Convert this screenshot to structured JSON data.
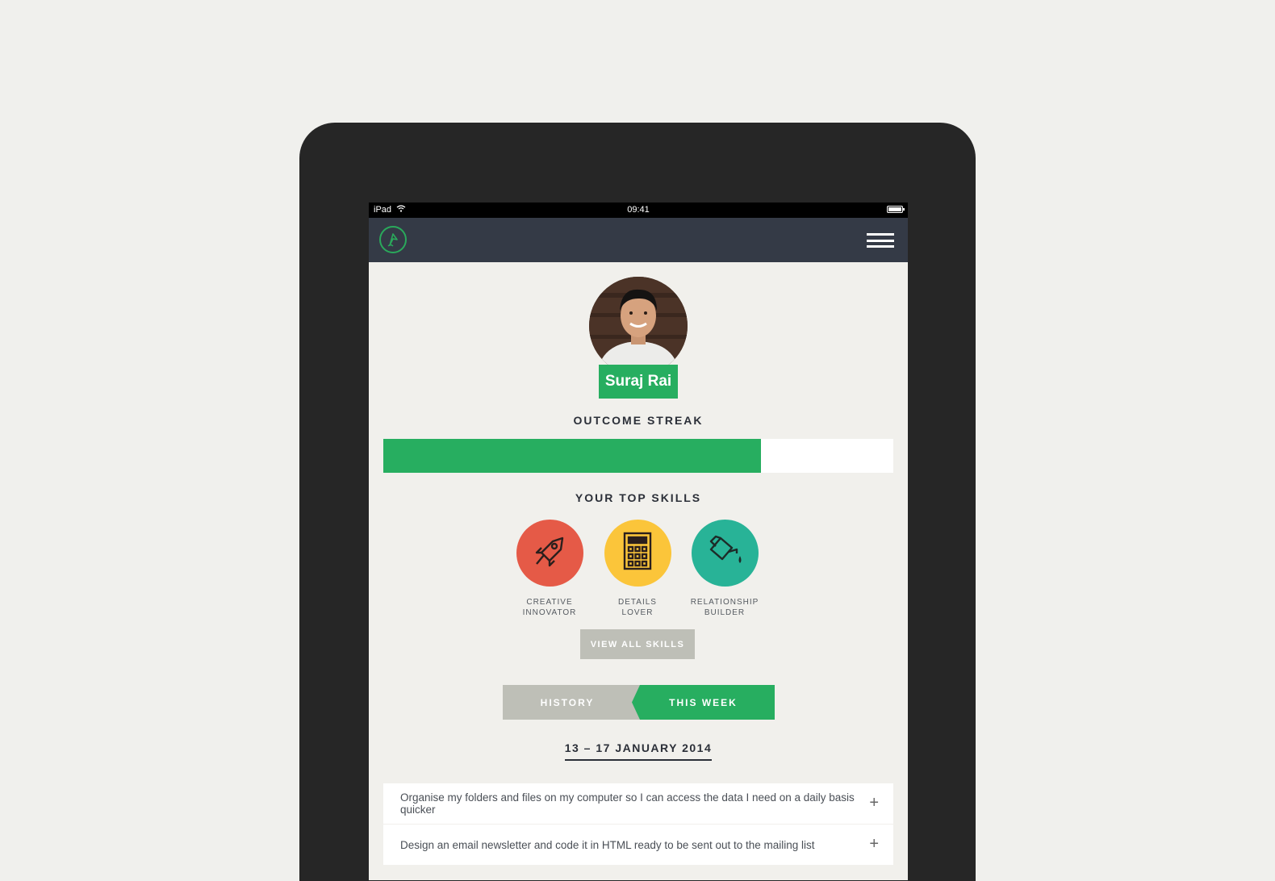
{
  "status_bar": {
    "device": "iPad",
    "time": "09:41"
  },
  "profile": {
    "name": "Suraj Rai"
  },
  "outcome_streak": {
    "title": "OUTCOME STREAK",
    "progress": 0.74
  },
  "skills": {
    "title": "YOUR TOP SKILLS",
    "items": [
      {
        "label": "CREATIVE\nINNOVATOR",
        "icon": "rocket-icon",
        "color": "#e55a47"
      },
      {
        "label": "DETAILS\nLOVER",
        "icon": "calculator-icon",
        "color": "#fbc53a"
      },
      {
        "label": "RELATIONSHIP\nBUILDER",
        "icon": "watering-can-icon",
        "color": "#28b397"
      }
    ],
    "view_all": "VIEW ALL SKILLS"
  },
  "tabs": {
    "history": "HISTORY",
    "this_week": "THIS WEEK",
    "active": "this_week"
  },
  "week_range": "13 – 17 JANUARY 2014",
  "tasks": [
    "Organise my folders and files on my computer so I can access the data I need on a daily basis quicker",
    "Design an email newsletter and code it in HTML ready to be sent out to the mailing list"
  ],
  "colors": {
    "accent": "#27ae60",
    "navbar": "#343a46",
    "muted_button": "#bebfb7"
  }
}
